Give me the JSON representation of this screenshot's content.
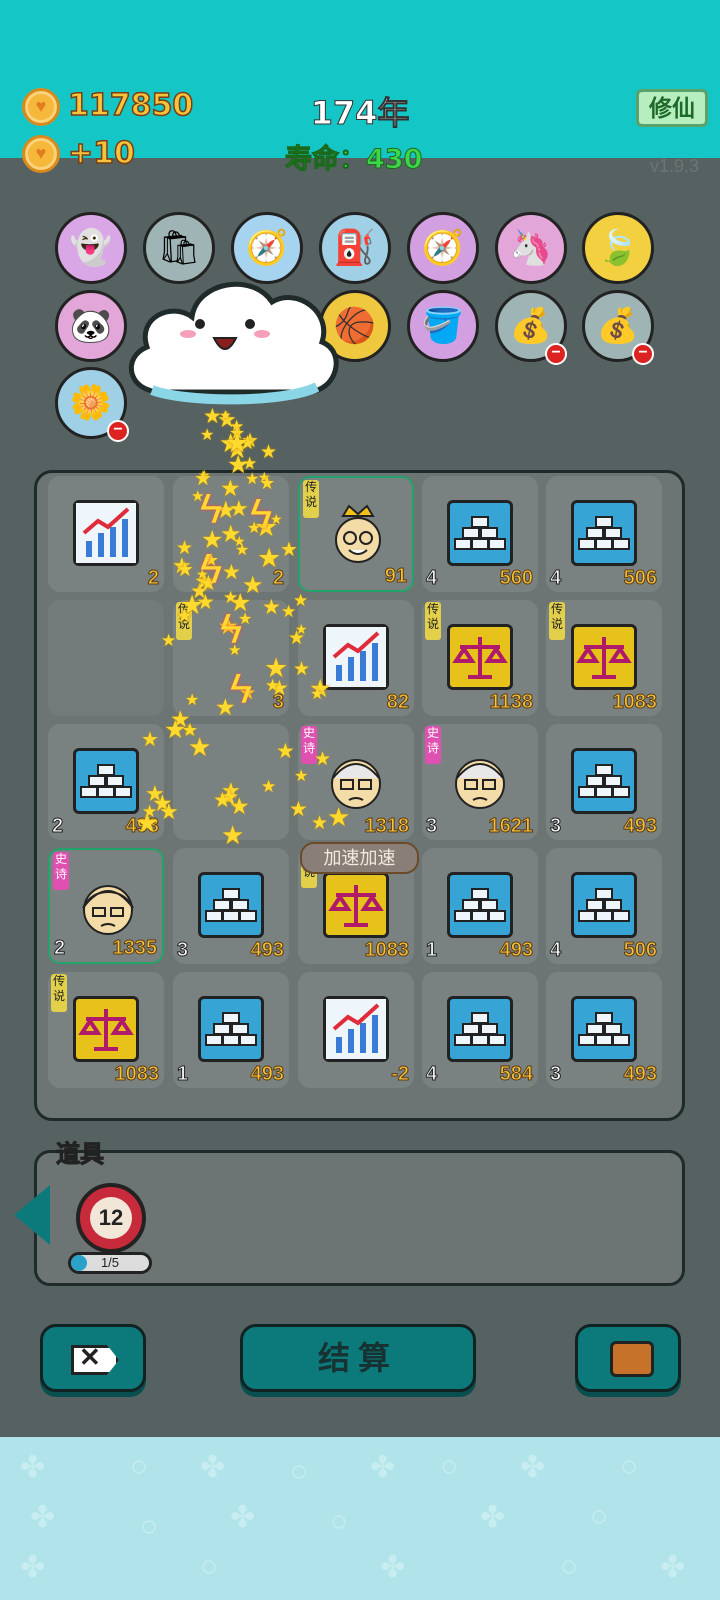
{
  "top": {
    "coins": "117850",
    "income": "+10",
    "year": "174年",
    "lifespan": "寿命：430",
    "cultivate_label": "修仙",
    "version": "v1.9.3"
  },
  "items": [
    {
      "name": "traffic-light-ghost-icon",
      "glyph": "👻",
      "bg": "#d9a6e6"
    },
    {
      "name": "recycle-bag-icon",
      "glyph": "🛍",
      "bg": "#9fb4b4"
    },
    {
      "name": "compass-icon",
      "glyph": "🧭",
      "bg": "#a6d4f0"
    },
    {
      "name": "pump-icon",
      "glyph": "⛽",
      "bg": "#9fd0e6"
    },
    {
      "name": "compass-purple-icon",
      "glyph": "🧭",
      "bg": "#d2a0e0"
    },
    {
      "name": "unicorn-icon",
      "glyph": "🦄",
      "bg": "#e2a6d8"
    },
    {
      "name": "leaf-icon",
      "glyph": "🍃",
      "bg": "#f2d040"
    },
    {
      "name": "panda-icon",
      "glyph": "🐼",
      "bg": "#e2a6d8"
    },
    {
      "name": "basketball-icon",
      "glyph": "🏀",
      "bg": "#f0c840"
    },
    {
      "name": "bucket-icon",
      "glyph": "🪣",
      "bg": "#d2a0e0"
    },
    {
      "name": "sack-icon",
      "glyph": "💰",
      "bg": "#9fb4b4"
    },
    {
      "name": "sack-2-icon",
      "glyph": "💰",
      "bg": "#9fb4b4"
    },
    {
      "name": "flower-pot-icon",
      "glyph": "🌼",
      "bg": "#9fd0e6"
    }
  ],
  "board": [
    {
      "kind": "chart",
      "lvl": "",
      "val": "2",
      "tag": ""
    },
    {
      "kind": "blank",
      "lvl": "",
      "val": "2",
      "tag": ""
    },
    {
      "kind": "king",
      "lvl": "",
      "val": "91",
      "tag": "传说"
    },
    {
      "kind": "gold",
      "lvl": "4",
      "val": "560",
      "tag": ""
    },
    {
      "kind": "gold",
      "lvl": "4",
      "val": "506",
      "tag": ""
    },
    {
      "kind": "empty",
      "lvl": "",
      "val": "",
      "tag": ""
    },
    {
      "kind": "blank",
      "lvl": "",
      "val": "3",
      "tag": "传说"
    },
    {
      "kind": "chart",
      "lvl": "",
      "val": "82",
      "tag": ""
    },
    {
      "kind": "scale",
      "lvl": "",
      "val": "1138",
      "tag": "传说"
    },
    {
      "kind": "scale",
      "lvl": "",
      "val": "1083",
      "tag": "传说"
    },
    {
      "kind": "gold",
      "lvl": "2",
      "val": "493",
      "tag": ""
    },
    {
      "kind": "blank",
      "lvl": "",
      "val": "",
      "tag": ""
    },
    {
      "kind": "oldman",
      "lvl": "",
      "val": "1318",
      "tag": "史诗"
    },
    {
      "kind": "oldman",
      "lvl": "3",
      "val": "1621",
      "tag": "史诗"
    },
    {
      "kind": "gold",
      "lvl": "3",
      "val": "493",
      "tag": ""
    },
    {
      "kind": "granny",
      "lvl": "2",
      "val": "1335",
      "tag": "史诗"
    },
    {
      "kind": "gold",
      "lvl": "3",
      "val": "493",
      "tag": ""
    },
    {
      "kind": "scale",
      "lvl": "",
      "val": "1083",
      "tag": "传说"
    },
    {
      "kind": "gold",
      "lvl": "1",
      "val": "493",
      "tag": ""
    },
    {
      "kind": "gold",
      "lvl": "4",
      "val": "506",
      "tag": ""
    },
    {
      "kind": "scale",
      "lvl": "",
      "val": "1083",
      "tag": "传说"
    },
    {
      "kind": "gold",
      "lvl": "1",
      "val": "493",
      "tag": ""
    },
    {
      "kind": "chart",
      "lvl": "",
      "val": "-2",
      "tag": ""
    },
    {
      "kind": "gold",
      "lvl": "4",
      "val": "584",
      "tag": ""
    },
    {
      "kind": "gold",
      "lvl": "3",
      "val": "493",
      "tag": ""
    }
  ],
  "speed_label": "加速加速",
  "props": {
    "title": "道具",
    "count": "12",
    "progress_text": "1/5",
    "progress": 0.2
  },
  "buttons": {
    "settle_label": "结算"
  }
}
